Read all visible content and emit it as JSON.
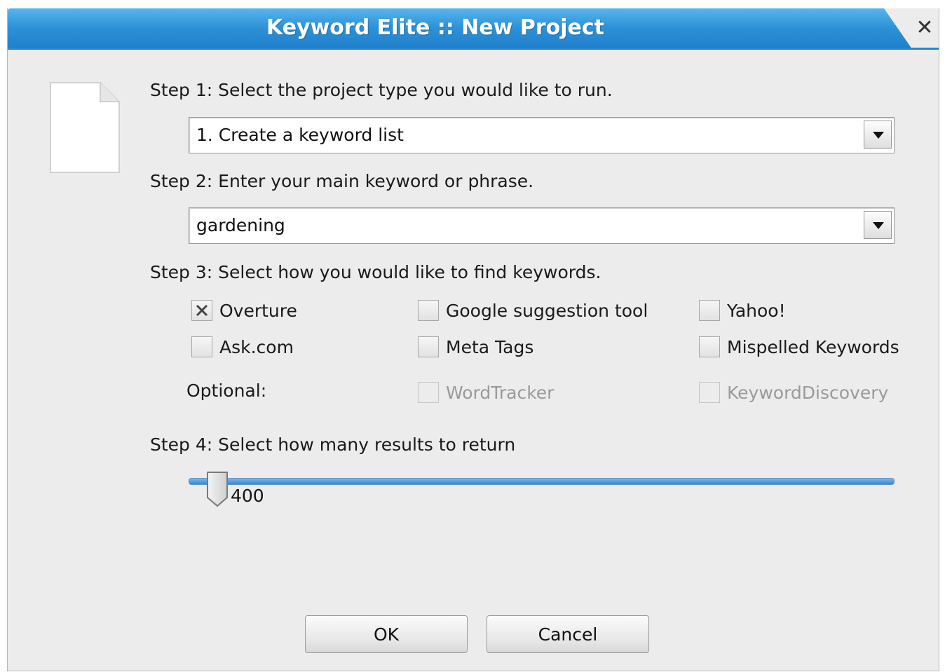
{
  "window": {
    "title": "Keyword Elite :: New Project",
    "close_glyph": "✕"
  },
  "step1": {
    "label": "Step 1: Select the project type you would like to run.",
    "project_type": "1. Create a keyword list"
  },
  "step2": {
    "label": "Step 2: Enter your main keyword or phrase.",
    "keyword": "gardening"
  },
  "step3": {
    "label": "Step 3: Select how you would like to find keywords.",
    "sources": [
      {
        "label": "Overture",
        "checked": true
      },
      {
        "label": "Google suggestion tool",
        "checked": false
      },
      {
        "label": "Yahoo!",
        "checked": false
      },
      {
        "label": "Ask.com",
        "checked": false
      },
      {
        "label": "Meta Tags",
        "checked": false
      },
      {
        "label": "Mispelled Keywords",
        "checked": false
      }
    ],
    "optional_label": "Optional:",
    "optional_sources": [
      {
        "label": "WordTracker",
        "checked": false,
        "enabled": false
      },
      {
        "label": "KeywordDiscovery",
        "checked": false,
        "enabled": false
      }
    ]
  },
  "step4": {
    "label": "Step 4: Select how many results to return",
    "results": "400"
  },
  "buttons": {
    "ok": "OK",
    "cancel": "Cancel"
  },
  "colors": {
    "title_bar": "#2f93d8",
    "dialog_bg": "#ececec",
    "slider": "#3a86cf"
  },
  "icons": {
    "document": "document-icon",
    "close": "close-icon",
    "dropdown": "chevron-down-icon",
    "check": "check-mark-icon",
    "slider_thumb": "slider-thumb-icon"
  }
}
